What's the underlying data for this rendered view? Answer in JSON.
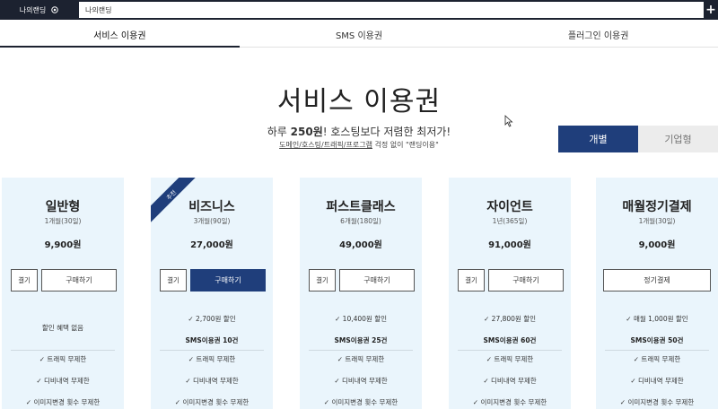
{
  "topbar": {
    "mypage_label": "나의랜딩",
    "tab_title": "나의랜딩",
    "plus_label": "+"
  },
  "tabs": [
    {
      "label": "서비스 이용권"
    },
    {
      "label": "SMS 이용권"
    },
    {
      "label": "플러그인 이용권"
    }
  ],
  "headline": {
    "title": "서비스 이용권",
    "sub_prefix": "하루 ",
    "sub_bold": "250원",
    "sub_suffix": "! 호스팅보다 저렴한 최저가!",
    "note_underlined": "도메인/호스팅/트래픽/프로그램",
    "note_rest": " 걱정 없이 \"랜딩이용\""
  },
  "toggle": {
    "individual": "개별",
    "corporate": "기업형"
  },
  "colors": {
    "brand_navy": "#1f3e7b",
    "card_bg": "#eaf5fc",
    "topbar": "#1c2230"
  },
  "cards": [
    {
      "name": "일반형",
      "period": "1개월(30일)",
      "price": "9,900원",
      "small_btn": "결기",
      "buy_btn": "구매하기",
      "features": [
        "할인 혜택 없음",
        "✓ 트래픽 무제한",
        "✓ 디비내역 무제한",
        "✓ 이미지변경 횟수 무제한"
      ]
    },
    {
      "name": "비즈니스",
      "period": "3개월(90일)",
      "price": "27,000원",
      "badge": "추천",
      "small_btn": "결기",
      "buy_btn": "구매하기",
      "features": [
        "✓ 2,700원 할인",
        "SMS이용권 10건",
        "✓ 트래픽 무제한",
        "✓ 디비내역 무제한",
        "✓ 이미지변경 횟수 무제한"
      ]
    },
    {
      "name": "퍼스트클래스",
      "period": "6개월(180일)",
      "price": "49,000원",
      "small_btn": "결기",
      "buy_btn": "구매하기",
      "features": [
        "✓ 10,400원 할인",
        "SMS이용권 25건",
        "✓ 트래픽 무제한",
        "✓ 디비내역 무제한",
        "✓ 이미지변경 횟수 무제한"
      ]
    },
    {
      "name": "자이언트",
      "period": "1년(365일)",
      "price": "91,000원",
      "small_btn": "결기",
      "buy_btn": "구매하기",
      "features": [
        "✓ 27,800원 할인",
        "SMS이용권 60건",
        "✓ 트래픽 무제한",
        "✓ 디비내역 무제한",
        "✓ 이미지변경 횟수 무제한"
      ]
    },
    {
      "name": "매월정기결제",
      "period": "1개월(30일)",
      "price": "9,000원",
      "wide_btn": "정기결제",
      "features": [
        "✓ 매월 1,000원 할인",
        "SMS이용권 50건",
        "✓ 트래픽 무제한",
        "✓ 디비내역 무제한",
        "✓ 이미지변경 횟수 무제한"
      ]
    }
  ]
}
